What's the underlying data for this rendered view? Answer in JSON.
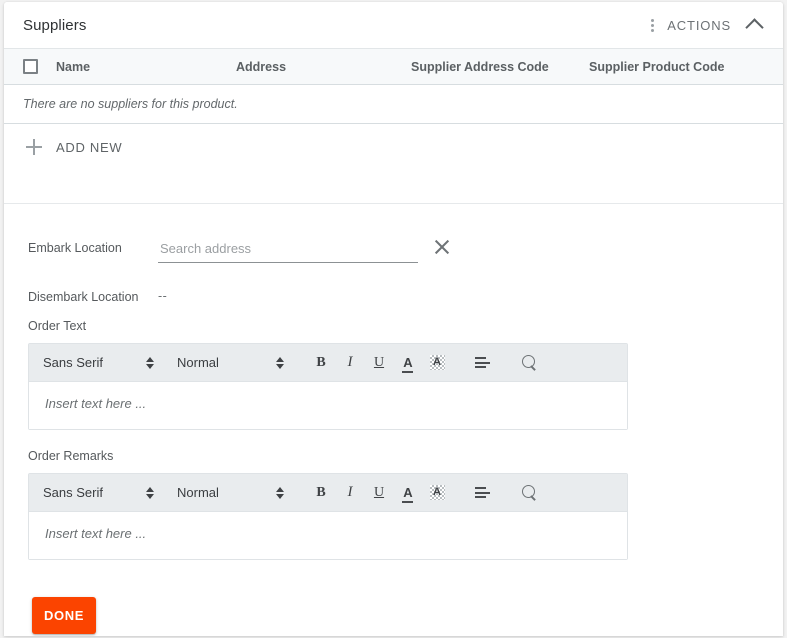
{
  "panel": {
    "title": "Suppliers",
    "actions_label": "ACTIONS",
    "kebab_icon": "more-vertical-icon",
    "collapse_icon": "chevron-up-icon"
  },
  "suppliers_table": {
    "columns": [
      "Name",
      "Address",
      "Supplier Address Code",
      "Supplier Product Code"
    ],
    "select_all_checked": false,
    "empty_message": "There are no suppliers for this product.",
    "add_new_label": "ADD NEW",
    "add_new_icon": "plus-icon"
  },
  "form": {
    "embark": {
      "label": "Embark Location",
      "placeholder": "Search address",
      "value": "",
      "clear_icon": "close-icon"
    },
    "disembark": {
      "label": "Disembark Location",
      "value": "--"
    },
    "order_text": {
      "label": "Order Text",
      "placeholder": "Insert text here ..."
    },
    "order_remarks": {
      "label": "Order Remarks",
      "placeholder": "Insert text here ..."
    }
  },
  "editor_toolbar": {
    "font_family": "Sans Serif",
    "font_size": "Normal",
    "bold": "B",
    "italic": "I",
    "underline": "U",
    "text_color": "A",
    "background_color": "A",
    "align_icon": "align-left-icon",
    "search_icon": "search-icon",
    "dropdown_icon": "up-down-arrows-icon"
  },
  "footer": {
    "done_label": "DONE",
    "done_color": "#fb4400"
  }
}
